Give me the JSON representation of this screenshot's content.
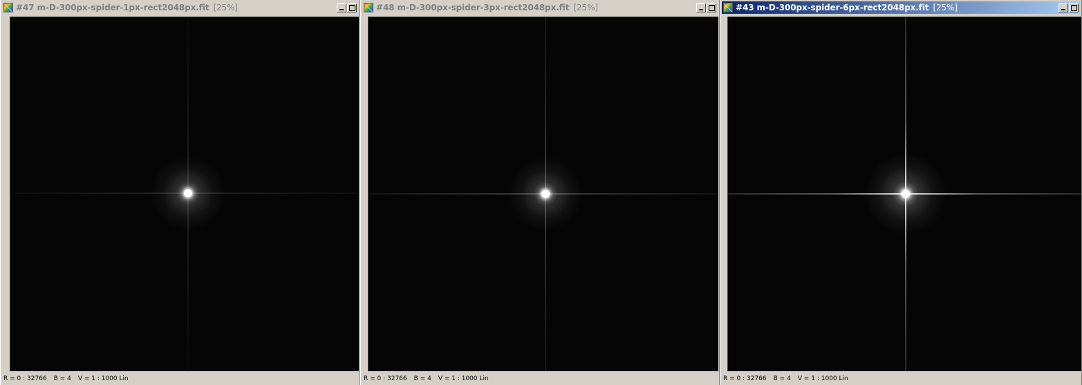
{
  "windows": [
    {
      "title": "#47 m-D-300px-spider-1px-rect2048px.fit",
      "zoom": "[25%]",
      "active": false,
      "status": {
        "range": "R = 0 : 32766",
        "bin": "B = 4",
        "visual": "V = 1 : 1000 Lin"
      }
    },
    {
      "title": "#48 m-D-300px-spider-3px-rect2048px.fit",
      "zoom": "[25%]",
      "active": false,
      "status": {
        "range": "R = 0 : 32766",
        "bin": "B = 4",
        "visual": "V = 1 : 1000 Lin"
      }
    },
    {
      "title": "#43 m-D-300px-spider-6px-rect2048px.fit",
      "zoom": "[25%]",
      "active": true,
      "status": {
        "range": "R = 0 : 32766",
        "bin": "B = 4",
        "visual": "V = 1 : 1000 Lin"
      }
    }
  ],
  "colors": {
    "titlebar_active_start": "#0a246a",
    "titlebar_active_end": "#a6caf0",
    "titlebar_inactive_text": "#808080",
    "window_face": "#d4d0c8",
    "image_background": "#050505"
  },
  "icons": {
    "app": "fits-image-icon",
    "minimize": "minimize-icon",
    "maximize": "maximize-icon"
  }
}
